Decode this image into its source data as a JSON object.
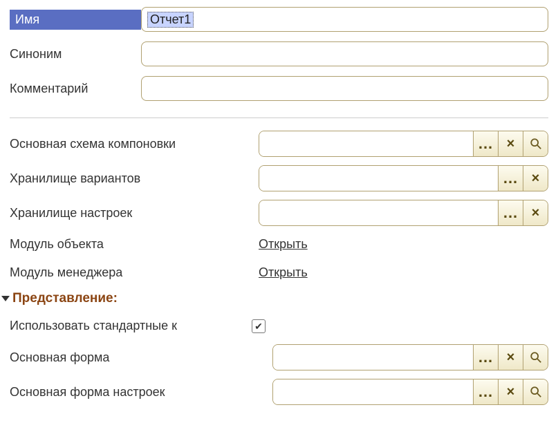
{
  "basic": {
    "name_label": "Имя",
    "name_value": "Отчет1",
    "synonym_label": "Синоним",
    "synonym_value": "",
    "comment_label": "Комментарий",
    "comment_value": ""
  },
  "group2": {
    "main_layout_label": "Основная схема компоновки",
    "main_layout_value": "",
    "variants_store_label": "Хранилище вариантов",
    "variants_store_value": "",
    "settings_store_label": "Хранилище настроек",
    "settings_store_value": "",
    "object_module_label": "Модуль объекта",
    "object_module_link": "Открыть",
    "manager_module_label": "Модуль менеджера",
    "manager_module_link": "Открыть"
  },
  "presentation": {
    "header": "Представление:",
    "use_std_label": "Использовать стандартные к",
    "use_std_checked": true,
    "main_form_label": "Основная форма",
    "main_form_value": "",
    "main_settings_form_label": "Основная форма настроек",
    "main_settings_form_value": ""
  },
  "icons": {
    "dots": "...",
    "x": "×",
    "search": "search"
  }
}
